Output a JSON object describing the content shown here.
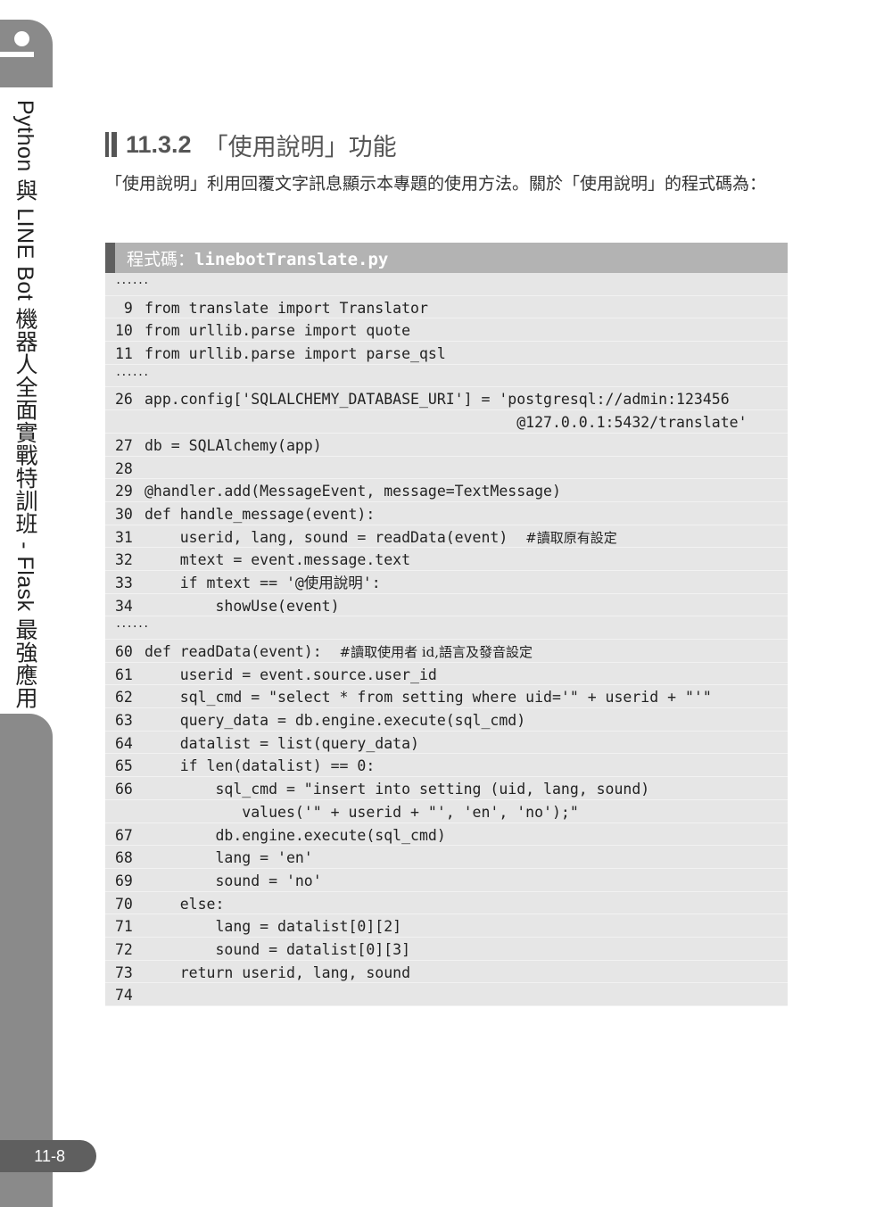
{
  "sidebar": {
    "book_title": "Python 與 LINE Bot 機器人全面實戰特訓班 - Flask 最強應用",
    "page_number": "11-8"
  },
  "section": {
    "number": "11.3.2",
    "title": "「使用說明」功能"
  },
  "paragraph": "「使用說明」利用回覆文字訊息顯示本專題的使用方法。關於「使用說明」的程式碼為：",
  "code": {
    "label": "程式碼：",
    "filename": "linebotTranslate.py",
    "lines": [
      {
        "n": "",
        "code": "......",
        "ellipsis": true
      },
      {
        "n": " 9",
        "code": "from translate import Translator"
      },
      {
        "n": "10",
        "code": "from urllib.parse import quote"
      },
      {
        "n": "11",
        "code": "from urllib.parse import parse_qsl"
      },
      {
        "n": "",
        "code": "......",
        "ellipsis": true
      },
      {
        "n": "26",
        "code": "app.config['SQLALCHEMY_DATABASE_URI'] = 'postgresql://admin:123456"
      },
      {
        "n": "",
        "code": "                                          @127.0.0.1:5432/translate'"
      },
      {
        "n": "27",
        "code": "db = SQLAlchemy(app)"
      },
      {
        "n": "28",
        "code": ""
      },
      {
        "n": "29",
        "code": "@handler.add(MessageEvent, message=TextMessage)"
      },
      {
        "n": "30",
        "code": "def handle_message(event):"
      },
      {
        "n": "31",
        "code": "    userid, lang, sound = readData(event)  ",
        "comment": "#讀取原有設定"
      },
      {
        "n": "32",
        "code": "    mtext = event.message.text"
      },
      {
        "n": "33",
        "code": "    if mtext == '@使用說明':"
      },
      {
        "n": "34",
        "code": "        showUse(event)"
      },
      {
        "n": "",
        "code": "......",
        "ellipsis": true
      },
      {
        "n": "60",
        "code": "def readData(event):  ",
        "comment": "#讀取使用者 id,語言及發音設定"
      },
      {
        "n": "61",
        "code": "    userid = event.source.user_id"
      },
      {
        "n": "62",
        "code": "    sql_cmd = \"select * from setting where uid='\" + userid + \"'\""
      },
      {
        "n": "63",
        "code": "    query_data = db.engine.execute(sql_cmd)"
      },
      {
        "n": "64",
        "code": "    datalist = list(query_data)"
      },
      {
        "n": "65",
        "code": "    if len(datalist) == 0:"
      },
      {
        "n": "66",
        "code": "        sql_cmd = \"insert into setting (uid, lang, sound)"
      },
      {
        "n": "",
        "code": "           values('\" + userid + \"', 'en', 'no');\""
      },
      {
        "n": "67",
        "code": "        db.engine.execute(sql_cmd)"
      },
      {
        "n": "68",
        "code": "        lang = 'en'"
      },
      {
        "n": "69",
        "code": "        sound = 'no'"
      },
      {
        "n": "70",
        "code": "    else:"
      },
      {
        "n": "71",
        "code": "        lang = datalist[0][2]"
      },
      {
        "n": "72",
        "code": "        sound = datalist[0][3]"
      },
      {
        "n": "73",
        "code": "    return userid, lang, sound"
      },
      {
        "n": "74",
        "code": ""
      }
    ]
  }
}
